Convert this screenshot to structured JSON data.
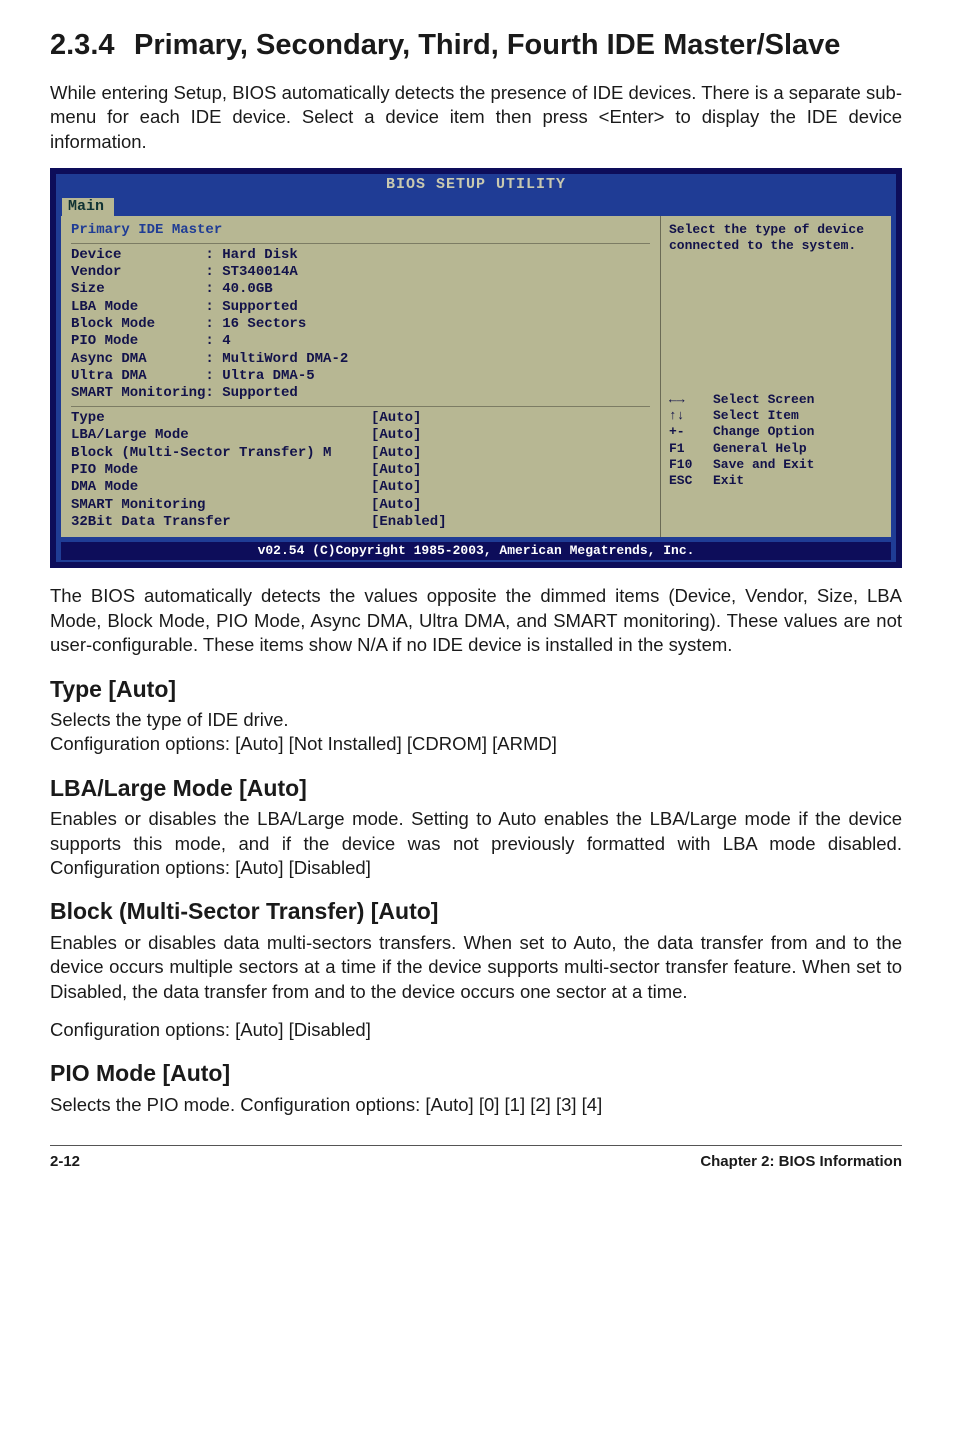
{
  "section_number": "2.3.4",
  "section_title": "Primary, Secondary, Third, Fourth IDE Master/Slave",
  "intro": "While entering Setup, BIOS automatically detects the presence of IDE devices. There is a separate sub-menu for each IDE device. Select a device item then press <Enter> to display the IDE device information.",
  "bios": {
    "window_title": "BIOS SETUP UTILITY",
    "tab": "Main",
    "left_heading": "Primary IDE Master",
    "dimmed_rows": [
      "Device          : Hard Disk",
      "Vendor          : ST340014A",
      "Size            : 40.0GB",
      "LBA Mode        : Supported",
      "Block Mode      : 16 Sectors",
      "PIO Mode        : 4",
      "Async DMA       : MultiWord DMA-2",
      "Ultra DMA       : Ultra DMA-5",
      "SMART Monitoring: Supported"
    ],
    "options": [
      {
        "label": "Type",
        "value": "[Auto]"
      },
      {
        "label": "LBA/Large Mode",
        "value": "[Auto]"
      },
      {
        "label": "Block (Multi-Sector Transfer) M",
        "value": "[Auto]"
      },
      {
        "label": "PIO Mode",
        "value": "[Auto]"
      },
      {
        "label": "DMA Mode",
        "value": "[Auto]"
      },
      {
        "label": "SMART Monitoring",
        "value": "[Auto]"
      },
      {
        "label": "32Bit Data Transfer",
        "value": "[Enabled]"
      }
    ],
    "help_text": "Select the type of device connected to the system.",
    "help_keys": [
      {
        "key": "←→",
        "desc": "Select Screen"
      },
      {
        "key": "↑↓",
        "desc": "Select Item"
      },
      {
        "key": "+-",
        "desc": "Change Option"
      },
      {
        "key": "F1",
        "desc": "General Help"
      },
      {
        "key": "F10",
        "desc": "Save and Exit"
      },
      {
        "key": "ESC",
        "desc": "Exit"
      }
    ],
    "footer": "v02.54 (C)Copyright 1985-2003, American Megatrends, Inc."
  },
  "after_bios": "The BIOS automatically detects the values opposite the dimmed items (Device, Vendor, Size, LBA Mode, Block Mode, PIO Mode, Async DMA, Ultra DMA, and SMART monitoring). These values are not user-configurable. These items show N/A if no IDE device is installed in the system.",
  "type_heading": "Type [Auto]",
  "type_p1": "Selects the type of IDE drive.",
  "type_p2": "Configuration options: [Auto] [Not Installed] [CDROM] [ARMD]",
  "lba_heading": "LBA/Large Mode [Auto]",
  "lba_p": "Enables or disables the LBA/Large mode. Setting to Auto enables the LBA/Large mode if the device supports this mode, and if the device was not previously formatted with LBA mode disabled. Configuration options: [Auto] [Disabled]",
  "block_heading": "Block (Multi-Sector Transfer) [Auto]",
  "block_p1": "Enables or disables data multi-sectors transfers. When set to Auto, the data transfer from and to the device occurs multiple sectors at a time if the device supports multi-sector transfer feature. When set to Disabled, the data transfer from and to the device occurs one sector at a time.",
  "block_p2": " Configuration options: [Auto] [Disabled]",
  "pio_heading": "PIO Mode [Auto]",
  "pio_p": "Selects the PIO mode. Configuration options: [Auto] [0] [1] [2] [3] [4]",
  "page_number": "2-12",
  "chapter_label": "Chapter 2: BIOS Information"
}
